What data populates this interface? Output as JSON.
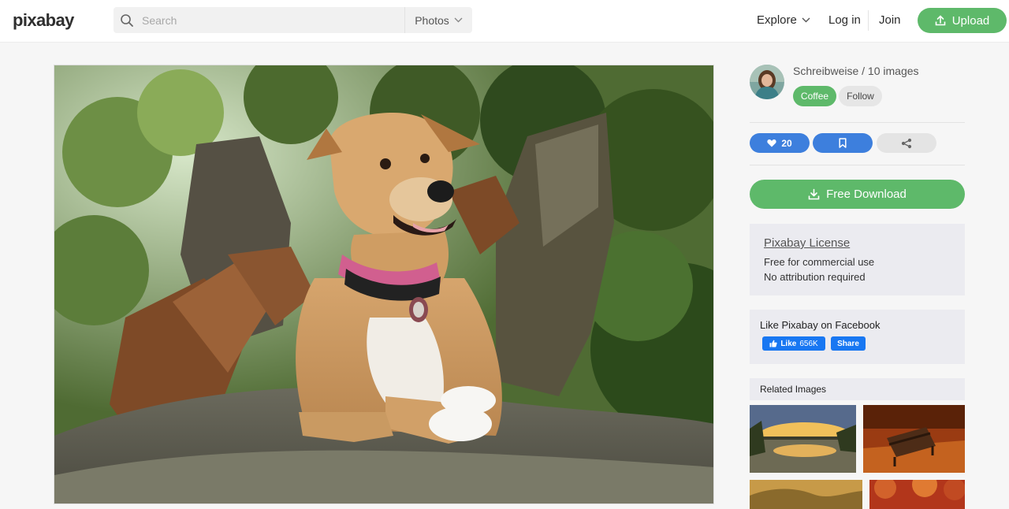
{
  "header": {
    "logo": "pixabay",
    "search": {
      "placeholder": "Search",
      "type_label": "Photos"
    },
    "nav": {
      "explore": "Explore",
      "login": "Log in",
      "join": "Join",
      "upload": "Upload"
    }
  },
  "photo": {
    "icon": "dog-photo"
  },
  "sidebar": {
    "author": {
      "name": "Schreibweise / 10 images",
      "coffee": "Coffee",
      "follow": "Follow"
    },
    "actions": {
      "likes": "20"
    },
    "download": "Free Download",
    "license": {
      "title": "Pixabay License",
      "line1": "Free for commercial use",
      "line2": "No attribution required"
    },
    "facebook": {
      "title": "Like Pixabay on Facebook",
      "like": "Like",
      "count": "656K",
      "share": "Share"
    },
    "related": {
      "title": "Related Images"
    }
  },
  "colors": {
    "green": "#5eb96a",
    "blue": "#3d7fdd",
    "facebook": "#1877f2",
    "panel": "#ebebf0"
  }
}
